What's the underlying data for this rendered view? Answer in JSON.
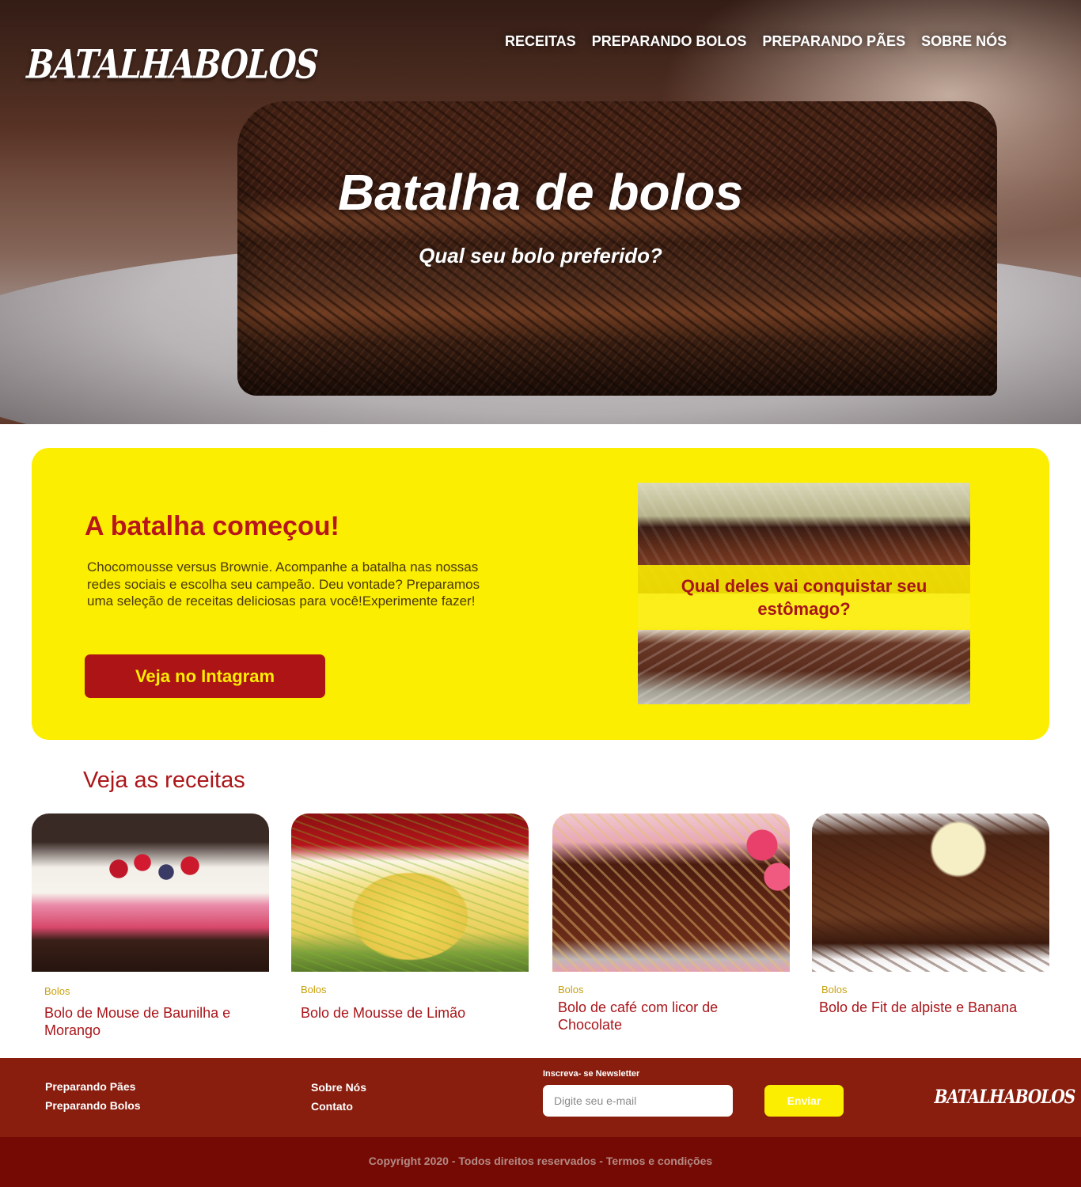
{
  "brand": {
    "logo_text": "BATALHABOLOS"
  },
  "nav": {
    "items": [
      {
        "label": "RECEITAS"
      },
      {
        "label": "PREPARANDO BOLOS"
      },
      {
        "label": "PREPARANDO PÃES"
      },
      {
        "label": "SOBRE NÓS"
      }
    ]
  },
  "hero": {
    "title": "Batalha de bolos",
    "subtitle": "Qual seu bolo preferido?"
  },
  "battle": {
    "title": "A batalha começou!",
    "text": "Chocomousse versus Brownie. Acompanhe a batalha nas nossas redes sociais e escolha seu campeão. Deu vontade? Preparamos uma seleção de receitas deliciosas para você!Experimente fazer!",
    "button_label": "Veja no Intagram",
    "image_question": "Qual deles vai conquistar seu estômago?"
  },
  "recipes": {
    "title": "Veja as receitas",
    "items": [
      {
        "tag": "Bolos",
        "name": "Bolo de Mouse de Baunilha e Morango"
      },
      {
        "tag": "Bolos",
        "name": "Bolo de Mousse de Limão"
      },
      {
        "tag": "Bolos",
        "name": "Bolo de café com licor de Chocolate"
      },
      {
        "tag": "Bolos",
        "name": "Bolo de Fit de alpiste e Banana"
      }
    ]
  },
  "footer": {
    "links_col1": [
      "Preparando Pães",
      "Preparando Bolos"
    ],
    "links_col2": [
      "Sobre Nós",
      "Contato"
    ],
    "newsletter_label": "Inscreva- se Newsletter",
    "newsletter_placeholder": "Digite seu e-mail",
    "newsletter_button": "Enviar",
    "logo_text": "BATALHABOLOS",
    "copyright": "Copyright  2020 - Todos direitos reservados - Termos e condições"
  },
  "colors": {
    "accent_yellow": "#fcee00",
    "brand_red": "#ac1416",
    "footer_brown": "#891e0e",
    "footer_dark": "#750a04"
  }
}
